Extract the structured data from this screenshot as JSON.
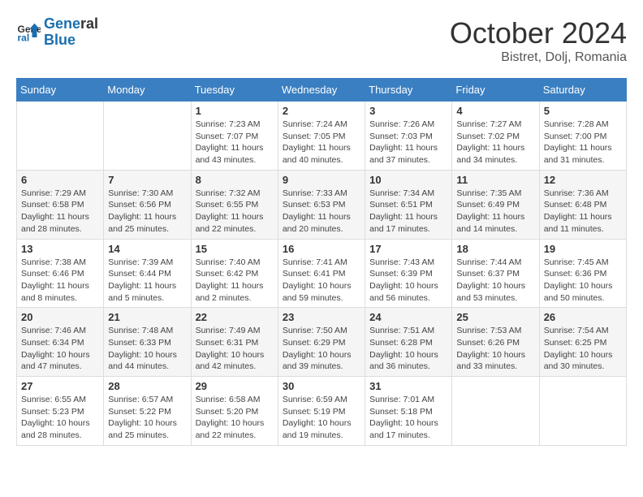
{
  "logo": {
    "line1": "General",
    "line2": "Blue"
  },
  "header": {
    "month": "October 2024",
    "location": "Bistret, Dolj, Romania"
  },
  "weekdays": [
    "Sunday",
    "Monday",
    "Tuesday",
    "Wednesday",
    "Thursday",
    "Friday",
    "Saturday"
  ],
  "weeks": [
    [
      {
        "day": "",
        "info": ""
      },
      {
        "day": "",
        "info": ""
      },
      {
        "day": "1",
        "info": "Sunrise: 7:23 AM\nSunset: 7:07 PM\nDaylight: 11 hours and 43 minutes."
      },
      {
        "day": "2",
        "info": "Sunrise: 7:24 AM\nSunset: 7:05 PM\nDaylight: 11 hours and 40 minutes."
      },
      {
        "day": "3",
        "info": "Sunrise: 7:26 AM\nSunset: 7:03 PM\nDaylight: 11 hours and 37 minutes."
      },
      {
        "day": "4",
        "info": "Sunrise: 7:27 AM\nSunset: 7:02 PM\nDaylight: 11 hours and 34 minutes."
      },
      {
        "day": "5",
        "info": "Sunrise: 7:28 AM\nSunset: 7:00 PM\nDaylight: 11 hours and 31 minutes."
      }
    ],
    [
      {
        "day": "6",
        "info": "Sunrise: 7:29 AM\nSunset: 6:58 PM\nDaylight: 11 hours and 28 minutes."
      },
      {
        "day": "7",
        "info": "Sunrise: 7:30 AM\nSunset: 6:56 PM\nDaylight: 11 hours and 25 minutes."
      },
      {
        "day": "8",
        "info": "Sunrise: 7:32 AM\nSunset: 6:55 PM\nDaylight: 11 hours and 22 minutes."
      },
      {
        "day": "9",
        "info": "Sunrise: 7:33 AM\nSunset: 6:53 PM\nDaylight: 11 hours and 20 minutes."
      },
      {
        "day": "10",
        "info": "Sunrise: 7:34 AM\nSunset: 6:51 PM\nDaylight: 11 hours and 17 minutes."
      },
      {
        "day": "11",
        "info": "Sunrise: 7:35 AM\nSunset: 6:49 PM\nDaylight: 11 hours and 14 minutes."
      },
      {
        "day": "12",
        "info": "Sunrise: 7:36 AM\nSunset: 6:48 PM\nDaylight: 11 hours and 11 minutes."
      }
    ],
    [
      {
        "day": "13",
        "info": "Sunrise: 7:38 AM\nSunset: 6:46 PM\nDaylight: 11 hours and 8 minutes."
      },
      {
        "day": "14",
        "info": "Sunrise: 7:39 AM\nSunset: 6:44 PM\nDaylight: 11 hours and 5 minutes."
      },
      {
        "day": "15",
        "info": "Sunrise: 7:40 AM\nSunset: 6:42 PM\nDaylight: 11 hours and 2 minutes."
      },
      {
        "day": "16",
        "info": "Sunrise: 7:41 AM\nSunset: 6:41 PM\nDaylight: 10 hours and 59 minutes."
      },
      {
        "day": "17",
        "info": "Sunrise: 7:43 AM\nSunset: 6:39 PM\nDaylight: 10 hours and 56 minutes."
      },
      {
        "day": "18",
        "info": "Sunrise: 7:44 AM\nSunset: 6:37 PM\nDaylight: 10 hours and 53 minutes."
      },
      {
        "day": "19",
        "info": "Sunrise: 7:45 AM\nSunset: 6:36 PM\nDaylight: 10 hours and 50 minutes."
      }
    ],
    [
      {
        "day": "20",
        "info": "Sunrise: 7:46 AM\nSunset: 6:34 PM\nDaylight: 10 hours and 47 minutes."
      },
      {
        "day": "21",
        "info": "Sunrise: 7:48 AM\nSunset: 6:33 PM\nDaylight: 10 hours and 44 minutes."
      },
      {
        "day": "22",
        "info": "Sunrise: 7:49 AM\nSunset: 6:31 PM\nDaylight: 10 hours and 42 minutes."
      },
      {
        "day": "23",
        "info": "Sunrise: 7:50 AM\nSunset: 6:29 PM\nDaylight: 10 hours and 39 minutes."
      },
      {
        "day": "24",
        "info": "Sunrise: 7:51 AM\nSunset: 6:28 PM\nDaylight: 10 hours and 36 minutes."
      },
      {
        "day": "25",
        "info": "Sunrise: 7:53 AM\nSunset: 6:26 PM\nDaylight: 10 hours and 33 minutes."
      },
      {
        "day": "26",
        "info": "Sunrise: 7:54 AM\nSunset: 6:25 PM\nDaylight: 10 hours and 30 minutes."
      }
    ],
    [
      {
        "day": "27",
        "info": "Sunrise: 6:55 AM\nSunset: 5:23 PM\nDaylight: 10 hours and 28 minutes."
      },
      {
        "day": "28",
        "info": "Sunrise: 6:57 AM\nSunset: 5:22 PM\nDaylight: 10 hours and 25 minutes."
      },
      {
        "day": "29",
        "info": "Sunrise: 6:58 AM\nSunset: 5:20 PM\nDaylight: 10 hours and 22 minutes."
      },
      {
        "day": "30",
        "info": "Sunrise: 6:59 AM\nSunset: 5:19 PM\nDaylight: 10 hours and 19 minutes."
      },
      {
        "day": "31",
        "info": "Sunrise: 7:01 AM\nSunset: 5:18 PM\nDaylight: 10 hours and 17 minutes."
      },
      {
        "day": "",
        "info": ""
      },
      {
        "day": "",
        "info": ""
      }
    ]
  ]
}
